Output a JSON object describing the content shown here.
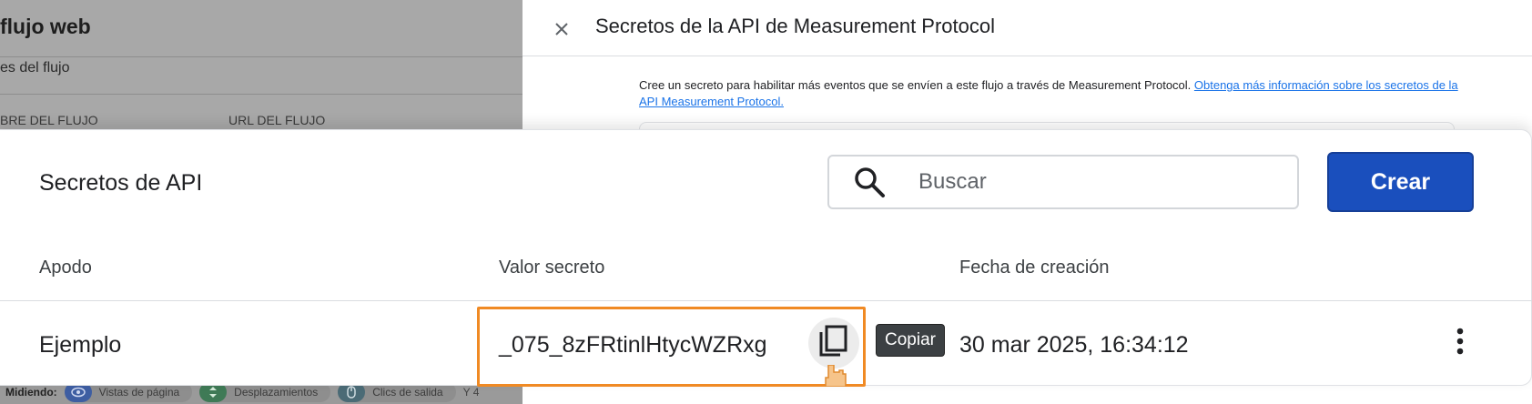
{
  "background_page": {
    "title": "flujo web",
    "subtitle": "es del flujo",
    "column_stream_name": "BRE DEL FLUJO",
    "column_stream_url": "URL DEL FLUJO",
    "bottom_bar": {
      "measuring_label": "Midiendo:",
      "chips": [
        {
          "icon": "eye-icon",
          "label": "Vistas de página"
        },
        {
          "icon": "scroll-icon",
          "label": "Desplazamientos"
        },
        {
          "icon": "mouse-icon",
          "label": "Clics de salida"
        }
      ],
      "more": "Y 4"
    }
  },
  "side_panel": {
    "title": "Secretos de la API de Measurement Protocol",
    "description": "Cree un secreto para habilitar más eventos que se envíen a este flujo a través de Measurement Protocol. ",
    "learn_more_link": "Obtenga más información sobre los secretos de la API Measurement Protocol."
  },
  "card": {
    "title": "Secretos de API",
    "search": {
      "placeholder": "Buscar",
      "value": ""
    },
    "create_button": "Crear",
    "columns": {
      "alias": "Apodo",
      "secret_value": "Valor secreto",
      "creation_date": "Fecha de creación"
    },
    "rows": [
      {
        "alias": "Ejemplo",
        "secret_value": "_075_8zFRtinlHtycWZRxg",
        "creation_date": "30 mar 2025, 16:34:12"
      }
    ],
    "copy_tooltip": "Copiar"
  },
  "colors": {
    "primary_button": "#1a4fbd",
    "highlight": "#f08a24",
    "link": "#1a73e8",
    "tooltip_bg": "#3c4043"
  }
}
